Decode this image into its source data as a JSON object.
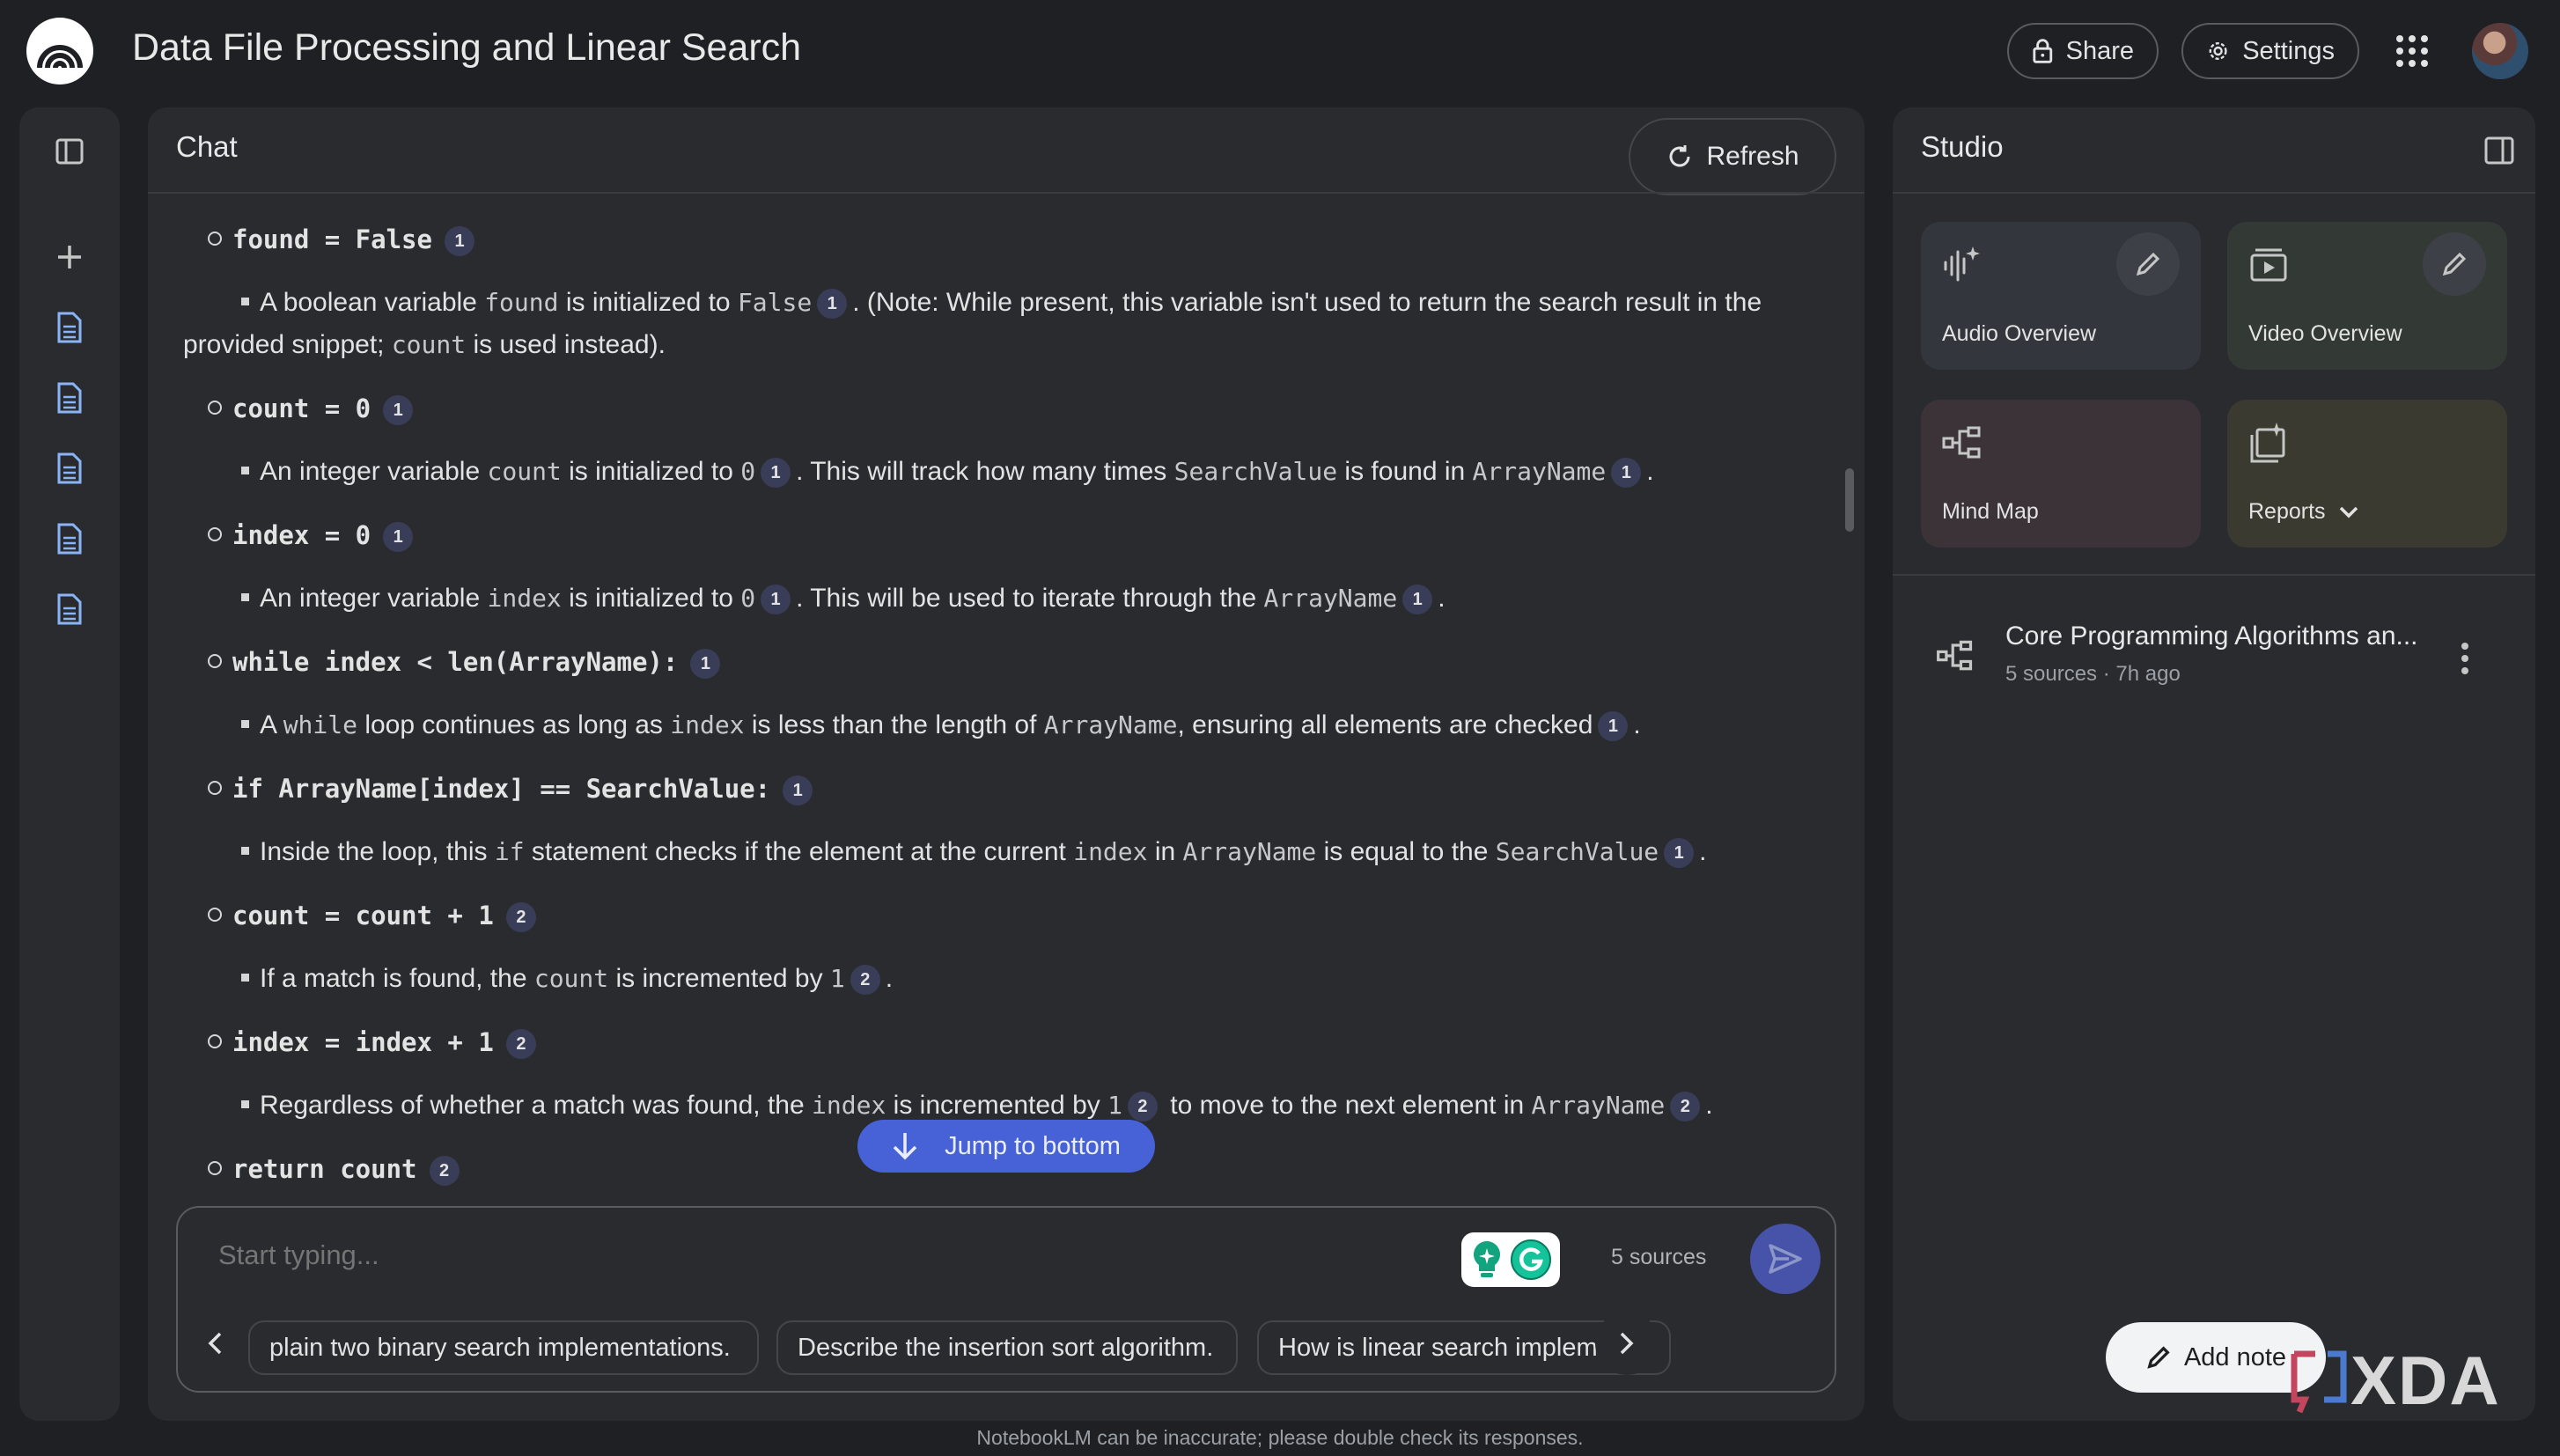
{
  "header": {
    "title": "Data File Processing and Linear Search",
    "share_label": "Share",
    "settings_label": "Settings"
  },
  "chat": {
    "title": "Chat",
    "refresh_label": "Refresh",
    "lines": {
      "l1": {
        "code": "found = False",
        "cite": "1"
      },
      "l2": {
        "t1": "A boolean variable ",
        "c1": "found",
        "t2": " is initialized to ",
        "c2": "False",
        "cite": "1",
        "t3": ". (Note: While present, this variable isn't used to return the search result in the"
      },
      "l2b": {
        "t1": "provided snippet; ",
        "c1": "count",
        "t2": " is used instead)."
      },
      "l3": {
        "code": "count = 0",
        "cite": "1"
      },
      "l4": {
        "t1": "An integer variable ",
        "c1": "count",
        "t2": " is initialized to ",
        "c2": "0",
        "cite1": "1",
        "t3": ". This will track how many times ",
        "c3": "SearchValue",
        "t4": " is found in ",
        "c4": "ArrayName",
        "cite2": "1",
        "t5": "."
      },
      "l5": {
        "code": "index = 0",
        "cite": "1"
      },
      "l6": {
        "t1": "An integer variable ",
        "c1": "index",
        "t2": " is initialized to ",
        "c2": "0",
        "cite1": "1",
        "t3": ". This will be used to iterate through the ",
        "c3": "ArrayName",
        "cite2": "1",
        "t4": "."
      },
      "l7": {
        "code": "while index < len(ArrayName):",
        "cite": "1"
      },
      "l8": {
        "t1": "A ",
        "c1": "while",
        "t2": " loop continues as long as ",
        "c2": "index",
        "t3": " is less than the length of ",
        "c3": "ArrayName",
        "t4": ", ensuring all elements are checked",
        "cite": "1",
        "t5": "."
      },
      "l9": {
        "code": "if ArrayName[index] == SearchValue:",
        "cite": "1"
      },
      "l10": {
        "t1": "Inside the loop, this ",
        "c1": "if",
        "t2": " statement checks if the element at the current ",
        "c2": "index",
        "t3": " in ",
        "c3": "ArrayName",
        "t4": " is equal to the ",
        "c4": "SearchValue",
        "cite": "1",
        "t5": "."
      },
      "l11": {
        "code": "count = count + 1",
        "cite": "2"
      },
      "l12": {
        "t1": "If a match is found, the ",
        "c1": "count",
        "t2": " is incremented by ",
        "c2": "1",
        "cite": "2",
        "t3": "."
      },
      "l13": {
        "code": "index = index + 1",
        "cite": "2"
      },
      "l14": {
        "t1": "Regardless of whether a match was found, the ",
        "c1": "index",
        "t2": " is incremented by ",
        "c2": "1",
        "cite1": "2",
        "t3": " to move to the next element in ",
        "c3": "ArrayName",
        "cite2": "2",
        "t4": "."
      },
      "l15": {
        "code": "return count",
        "cite": "2"
      }
    },
    "jump_label": "Jump to bottom",
    "input_placeholder": "Start typing...",
    "sources_count": "5 sources",
    "chips": [
      "plain two binary search implementations.",
      "Describe the insertion sort algorithm.",
      "How is linear search implemente"
    ]
  },
  "studio": {
    "title": "Studio",
    "cards": [
      {
        "label": "Audio Overview",
        "color": "#33363d"
      },
      {
        "label": "Video Overview",
        "color": "#333a36"
      },
      {
        "label": "Mind Map",
        "color": "#3b3337"
      },
      {
        "label": "Reports",
        "color": "#3b3a30"
      }
    ],
    "note": {
      "title": "Core Programming Algorithms an...",
      "subtitle": "5 sources · 7h ago"
    },
    "add_note_label": "Add note"
  },
  "watermark": "XDA",
  "footer": "NotebookLM can be inaccurate; please double check its responses."
}
